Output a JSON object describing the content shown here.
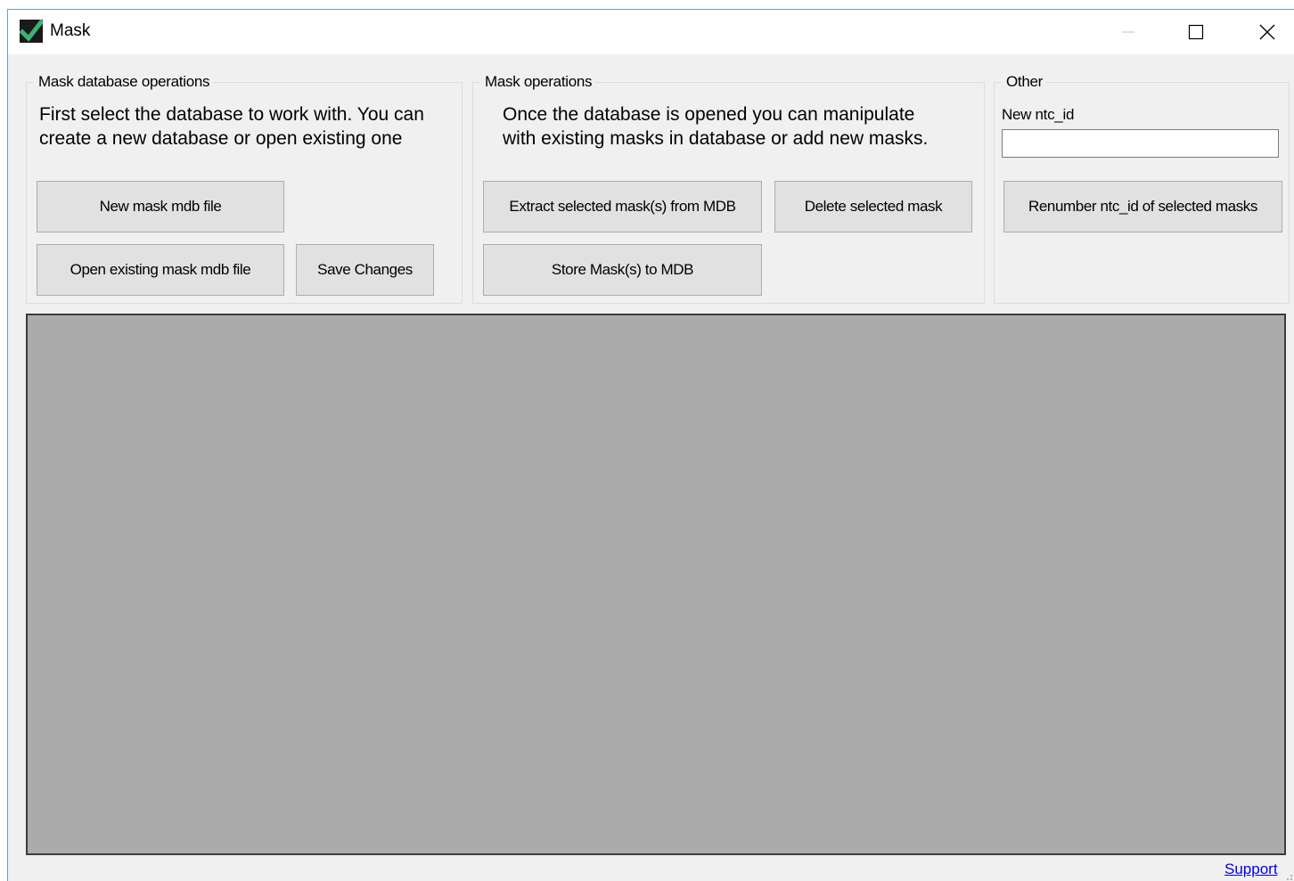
{
  "window": {
    "title": "Mask",
    "icon": "checkmark-app-icon",
    "controls": {
      "minimize": "minimize-icon",
      "maximize": "maximize-icon",
      "close": "close-icon"
    }
  },
  "db_group": {
    "legend": "Mask database operations",
    "description": "First select the database to work with. You can\ncreate a new database or open existing one",
    "new_button": "New mask mdb file",
    "open_button": "Open existing mask mdb file",
    "save_button": "Save Changes"
  },
  "mask_group": {
    "legend": "Mask operations",
    "description": "Once the database is opened you can manipulate\nwith existing masks in database or add new masks.",
    "extract_button": "Extract selected mask(s) from MDB",
    "delete_button": "Delete selected mask",
    "store_button": "Store Mask(s) to MDB"
  },
  "other_group": {
    "legend": "Other",
    "ntc_label": "New ntc_id",
    "ntc_value": "",
    "renumber_button": "Renumber ntc_id of selected masks"
  },
  "footer": {
    "support_link": "Support"
  },
  "colors": {
    "window_bg": "#f0f0f0",
    "view_bg": "#ababab",
    "button_bg": "#e1e1e1",
    "link": "#0000ee",
    "icon_check": "#3cb371"
  }
}
